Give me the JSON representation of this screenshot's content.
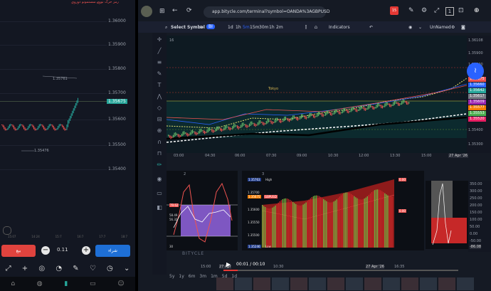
{
  "left_app": {
    "header_text": "رمز حرک نووۍ سستمونو دوروي",
    "price_levels": [
      "1.36000",
      "1.35900",
      "1.35800",
      "1.35700",
      "1.35600",
      "1.35500",
      "1.35400"
    ],
    "current_price": "1.35675",
    "high_label": "1.35761",
    "low_label": "1.35476",
    "time_labels": [
      "15:07",
      "14:24",
      "15:7",
      "16:7",
      "17:7",
      "18:7"
    ],
    "sell_label": "بيع",
    "lot_value": "0.11",
    "buy_label": "شراء",
    "colors": {
      "up": "#26a69a",
      "down": "#ef5350",
      "sell_btn": "#e0433e",
      "buy_btn": "#1e6fd6"
    }
  },
  "browser": {
    "url": "app.bitycle.com/terminal?symbol=OANDA%3AGBPUSD",
    "notification_count": "15",
    "tabs_count": "1"
  },
  "toolbar": {
    "select_symbol": "Select Symbol",
    "intervals": [
      "1d",
      "1h",
      "5m",
      "15m",
      "30m",
      "1h",
      "2m"
    ],
    "active_interval": "5m",
    "indicators_label": "Indicators",
    "layout_name": "UnNamed",
    "bi_label": "BI"
  },
  "main_chart": {
    "pane_label": "16",
    "tokyo_label": "Tokyo",
    "time_axis": [
      "03:00",
      "04:30",
      "06:00",
      "07:30",
      "09:00",
      "10:30",
      "12:00",
      "13:30",
      "15:00",
      "16:30"
    ],
    "date_label": "27 Apr '26",
    "right_prices": [
      "1.36108",
      "1.35900",
      "1.35800",
      "1.35700",
      "1.35600",
      "1.35500",
      "1.35400",
      "1.35300"
    ],
    "price_tags": [
      {
        "text": "1.35675",
        "color": "#ef5350"
      },
      {
        "text": "1.35660",
        "color": "#2962ff"
      },
      {
        "text": "1.35642",
        "color": "#26a69a"
      },
      {
        "text": "1.35617",
        "color": "#787b86"
      },
      {
        "text": "1.35609",
        "color": "#9c27b0"
      },
      {
        "text": "1.35577",
        "color": "#f57c00"
      },
      {
        "text": "1.35553",
        "color": "#4caf50"
      },
      {
        "text": "1.35520",
        "color": "#e91e63"
      }
    ]
  },
  "sub_panes": {
    "pane2_label": "2",
    "pane3_label": "3",
    "osc_values": [
      "79.62",
      "58.49",
      "56.32",
      "30"
    ],
    "mid_prices": [
      "1.35763",
      "1.35700",
      "1.35675",
      "1.35600",
      "1.35550",
      "1.35500",
      "1.35246"
    ],
    "high_label": "High",
    "low_label": "Low",
    "symbol_tag": "GBPUSD",
    "zero_labels": [
      "0.00",
      "0.00",
      "-0.00"
    ],
    "right_scale": [
      "350.00",
      "300.00",
      "250.00",
      "200.00",
      "150.00",
      "100.00",
      "50.00",
      "0.00",
      "-50.00",
      "-86.08"
    ],
    "times": [
      "15:00",
      "27 Apr",
      "10:30",
      "27 Apr '26",
      "16:35"
    ],
    "brand": "BITYCLE"
  },
  "video": {
    "time": "00:01 / 00:10"
  },
  "bottom_intervals": [
    "5y",
    "1y",
    "6m",
    "3m",
    "1m",
    "5d",
    "1d"
  ]
}
